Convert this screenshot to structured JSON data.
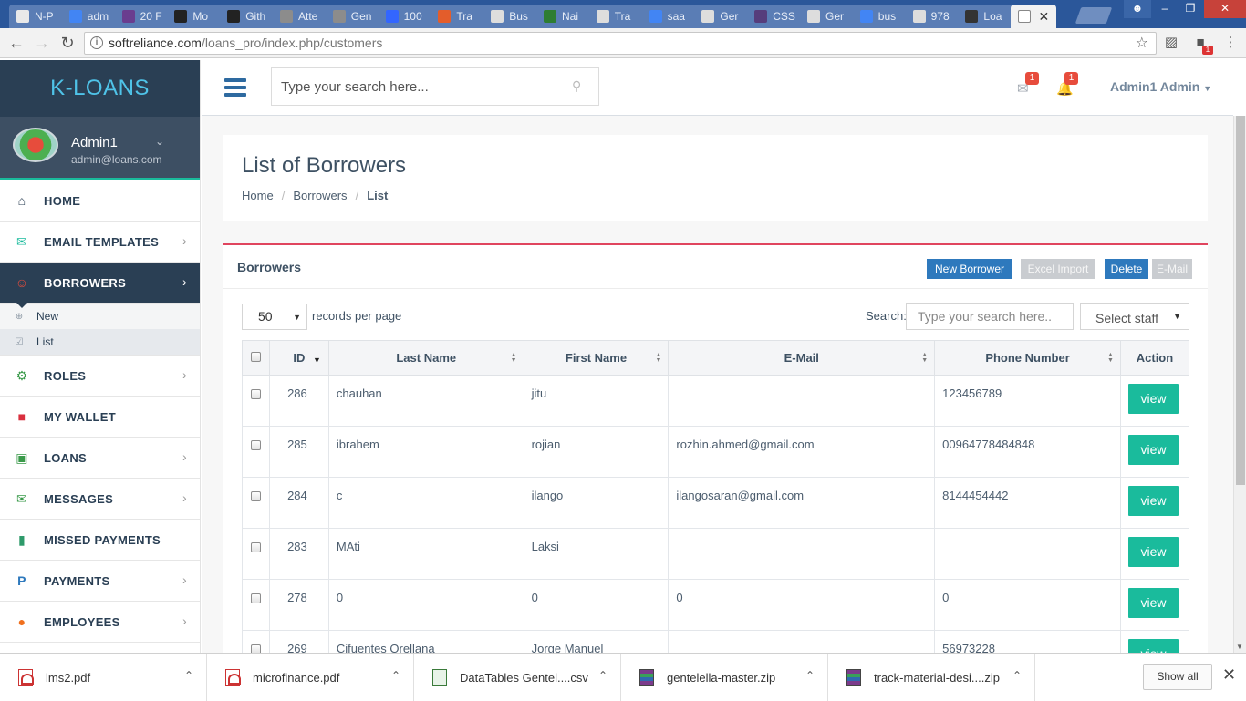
{
  "browser": {
    "tabs": [
      {
        "title": "N-P",
        "color": "#e9e9e9"
      },
      {
        "title": "adm",
        "color": "#4285f4"
      },
      {
        "title": "20 F",
        "color": "#6a3d8f"
      },
      {
        "title": "Mo",
        "color": "#222222"
      },
      {
        "title": "Gith",
        "color": "#222222"
      },
      {
        "title": "Atte",
        "color": "#8c8c8c"
      },
      {
        "title": "Gen",
        "color": "#8c8c8c"
      },
      {
        "title": "100",
        "color": "#3366ff"
      },
      {
        "title": "Tra",
        "color": "#e35d2b"
      },
      {
        "title": "Bus",
        "color": "#dddddd"
      },
      {
        "title": "Nai",
        "color": "#2e7d32"
      },
      {
        "title": "Tra",
        "color": "#dddddd"
      },
      {
        "title": "saa",
        "color": "#4285f4"
      },
      {
        "title": "Ger",
        "color": "#dddddd"
      },
      {
        "title": "CSS",
        "color": "#563d7c"
      },
      {
        "title": "Ger",
        "color": "#dddddd"
      },
      {
        "title": "bus",
        "color": "#4285f4"
      },
      {
        "title": "978",
        "color": "#dddddd"
      },
      {
        "title": "Loa",
        "color": "#333333"
      }
    ],
    "url_host": "softreliance.com",
    "url_path": "/loans_pro/index.php/customers",
    "ext_badge": "1"
  },
  "sidebar": {
    "brand": "K-LOANS",
    "profile_name": "Admin1",
    "profile_email": "admin@loans.com",
    "menu": [
      {
        "label": "HOME",
        "icon": "home-icon",
        "color": "#2a3f54",
        "chevron": false
      },
      {
        "label": "EMAIL TEMPLATES",
        "icon": "envelope-icon",
        "color": "#1abb9c",
        "chevron": true
      },
      {
        "label": "BORROWERS",
        "icon": "smile-icon",
        "color": "#e74c3c",
        "chevron": true,
        "active": true
      },
      {
        "label": "ROLES",
        "icon": "cogs-icon",
        "color": "#3a9a4a",
        "chevron": true
      },
      {
        "label": "MY WALLET",
        "icon": "briefcase-icon",
        "color": "#d9303e",
        "chevron": false
      },
      {
        "label": "LOANS",
        "icon": "money-icon",
        "color": "#3a9a4a",
        "chevron": true
      },
      {
        "label": "MESSAGES",
        "icon": "envelope-icon",
        "color": "#3a9a4a",
        "chevron": true
      },
      {
        "label": "MISSED PAYMENTS",
        "icon": "file-icon",
        "color": "#2e9a6a",
        "chevron": false
      },
      {
        "label": "PAYMENTS",
        "icon": "paypal-icon",
        "color": "#2e79bd",
        "chevron": true
      },
      {
        "label": "EMPLOYEES",
        "icon": "users-icon",
        "color": "#f0701e",
        "chevron": true
      }
    ],
    "submenu": [
      {
        "label": "New",
        "icon": "plus-circle-icon"
      },
      {
        "label": "List",
        "icon": "check-square-icon",
        "active": true
      }
    ]
  },
  "header": {
    "search_placeholder": "Type your search here...",
    "mail_badge": "1",
    "bell_badge": "1",
    "user": "Admin1 Admin"
  },
  "page": {
    "title": "List of Borrowers",
    "breadcrumb": [
      "Home",
      "Borrowers",
      "List"
    ]
  },
  "panel": {
    "title": "Borrowers",
    "buttons": {
      "new": "New Borrower",
      "excel": "Excel Import",
      "delete": "Delete",
      "email": "E-Mail"
    },
    "per_page_value": "50",
    "per_page_label": "records per page",
    "search_label": "Search:",
    "search_placeholder": "Type your search here..",
    "staff_select": "Select staff"
  },
  "table": {
    "columns": [
      "ID",
      "Last Name",
      "First Name",
      "E-Mail",
      "Phone Number",
      "Action"
    ],
    "rows": [
      {
        "id": "286",
        "last": "chauhan",
        "first": "jitu",
        "email": "",
        "phone": "123456789",
        "action": "view"
      },
      {
        "id": "285",
        "last": "ibrahem",
        "first": "rojian",
        "email": "rozhin.ahmed@gmail.com",
        "phone": "00964778484848",
        "action": "view"
      },
      {
        "id": "284",
        "last": "c",
        "first": "ilango",
        "email": "ilangosaran@gmail.com",
        "phone": "8144454442",
        "action": "view"
      },
      {
        "id": "283",
        "last": "MAti",
        "first": "Laksi",
        "email": "",
        "phone": "",
        "action": "view"
      },
      {
        "id": "278",
        "last": "0",
        "first": "0",
        "email": "0",
        "phone": "0",
        "action": "view"
      },
      {
        "id": "269",
        "last": "Cifuentes Orellana",
        "first": "Jorge Manuel",
        "email": "",
        "phone": "56973228",
        "action": "view"
      }
    ]
  },
  "downloads": {
    "items": [
      {
        "name": "lms2.pdf",
        "type": "pdf"
      },
      {
        "name": "microfinance.pdf",
        "type": "pdf"
      },
      {
        "name": "DataTables  Gentel....csv",
        "type": "csv"
      },
      {
        "name": "gentelella-master.zip",
        "type": "zip"
      },
      {
        "name": "track-material-desi....zip",
        "type": "zip"
      }
    ],
    "show_all": "Show all"
  }
}
